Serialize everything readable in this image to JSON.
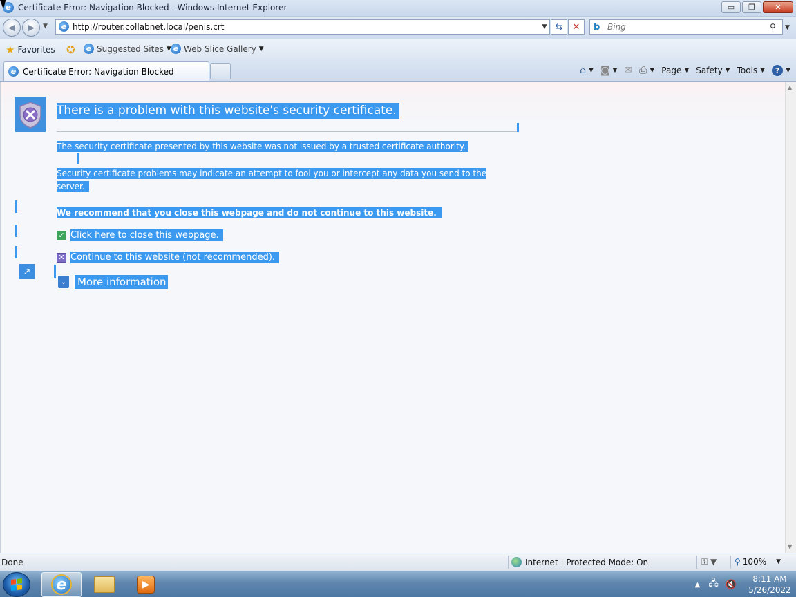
{
  "window": {
    "title": "Certificate Error: Navigation Blocked - Windows Internet Explorer",
    "minimize": "▭",
    "restore": "❐",
    "close": "✕"
  },
  "address": {
    "url": "http://router.collabnet.local/penis.crt",
    "search_placeholder": "Bing"
  },
  "favorites": {
    "favorites_label": "Favorites",
    "suggested_sites": "Suggested Sites",
    "web_slice_gallery": "Web Slice Gallery"
  },
  "tab": {
    "label": "Certificate Error: Navigation Blocked"
  },
  "commands": {
    "page": "Page",
    "safety": "Safety",
    "tools": "Tools"
  },
  "content": {
    "heading": "There is a problem with this website's security certificate.",
    "para1": "The security certificate presented by this website was not issued by a trusted certificate authority.",
    "para2": "Security certificate problems may indicate an attempt to fool you or intercept any data you send to the server.",
    "recommend": "We recommend that you close this webpage and do not continue to this website.",
    "close_link": "Click here to close this webpage.",
    "continue_link": "Continue to this website (not recommended).",
    "more_info": "More information"
  },
  "status": {
    "text": "Done",
    "zone": "Internet | Protected Mode: On",
    "zoom": "100%"
  },
  "taskbar": {
    "time": "8:11 AM",
    "date": "5/26/2022"
  },
  "colors": {
    "selection": "#3b99f0",
    "shield": "#3f90de"
  }
}
